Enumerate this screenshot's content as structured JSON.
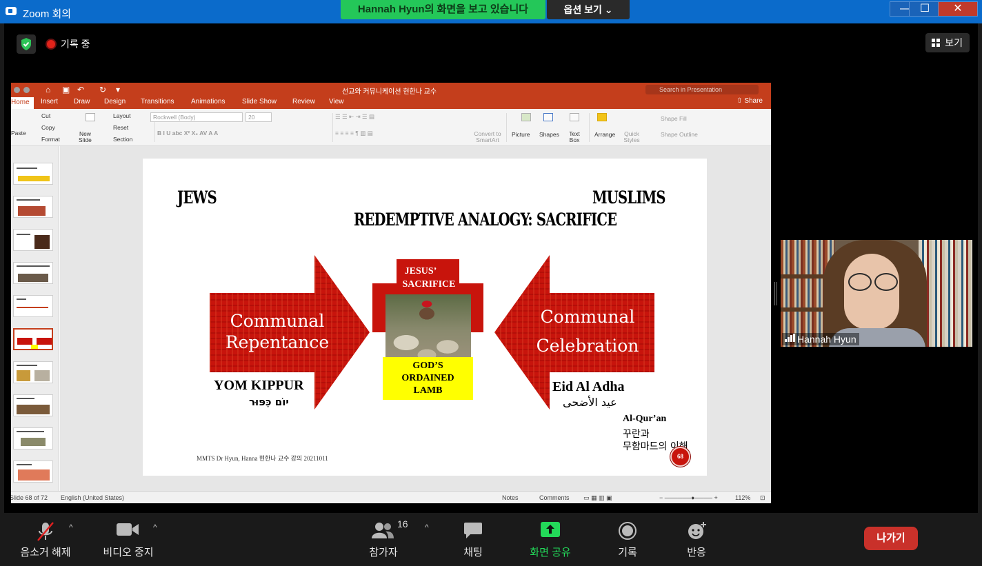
{
  "window": {
    "title": "Zoom 회의",
    "share_banner": "Hannah Hyun의 화면을 보고 있습니다",
    "options": "옵션 보기 ⌄",
    "minimize": "—",
    "maximize": "☐",
    "close": "✕"
  },
  "top": {
    "recording": "기록 중",
    "view": "보기"
  },
  "ppt": {
    "doc_title": "선교와 커뮤니케이션 현한나 교수",
    "search_placeholder": "Search in Presentation",
    "share": "Share",
    "tabs": [
      "Home",
      "Insert",
      "Draw",
      "Design",
      "Transitions",
      "Animations",
      "Slide Show",
      "Review",
      "View"
    ],
    "ribbon": {
      "paste": "Paste",
      "cut": "Cut",
      "copy": "Copy",
      "format": "Format",
      "new_slide": "New\nSlide",
      "layout": "Layout",
      "reset": "Reset",
      "section": "Section",
      "font_name": "Rockwell (Body)",
      "font_size": "20",
      "convert_smartart": "Convert to SmartArt",
      "picture": "Picture",
      "shapes": "Shapes",
      "text_box": "Text Box",
      "arrange": "Arrange",
      "quick_styles": "Quick Styles",
      "shape_fill": "Shape Fill",
      "shape_outline": "Shape Outline"
    },
    "status": {
      "slide": "Slide 68 of 72",
      "language": "English (United States)",
      "notes": "Notes",
      "comments": "Comments",
      "zoom": "112%"
    }
  },
  "slide": {
    "left_header": "JEWS",
    "right_header": "MUSLIMS",
    "title": "REDEMPTIVE ANALOGY: SACRIFICE",
    "left_arrow_line1": "Communal",
    "left_arrow_line2": "Repentance",
    "right_arrow_line1": "Communal",
    "right_arrow_line2": "Celebration",
    "cross_line1": "JESUS’",
    "cross_line2": "SACRIFICE",
    "lamb_line1": "GOD’S",
    "lamb_line2": "ORDAINED",
    "lamb_line3": "LAMB",
    "yom_kippur": "YOM KIPPUR",
    "yom_kippur_hebrew": "יוֹם כִּפּוּר",
    "eid": "Eid Al Adha",
    "eid_arabic": "عيد الأضحى",
    "quran": "Al-Qur’an",
    "quran_ko1": "꾸란과",
    "quran_ko2": "무함마드의 이해",
    "footer": "MMTS Dr Hyun, Hanna 현한나 교수 강의 20211011",
    "page": "68",
    "colors": {
      "arrow_red": "#c8140c",
      "lamb_yellow": "#ffff00"
    }
  },
  "participant": {
    "name": "Hannah Hyun"
  },
  "toolbar": {
    "unmute": "음소거 해제",
    "stop_video": "비디오 중지",
    "participants": "참가자",
    "participant_count": "16",
    "chat": "채팅",
    "share_screen": "화면 공유",
    "record": "기록",
    "reactions": "반응",
    "leave": "나가기",
    "share_color": "#23d959"
  }
}
